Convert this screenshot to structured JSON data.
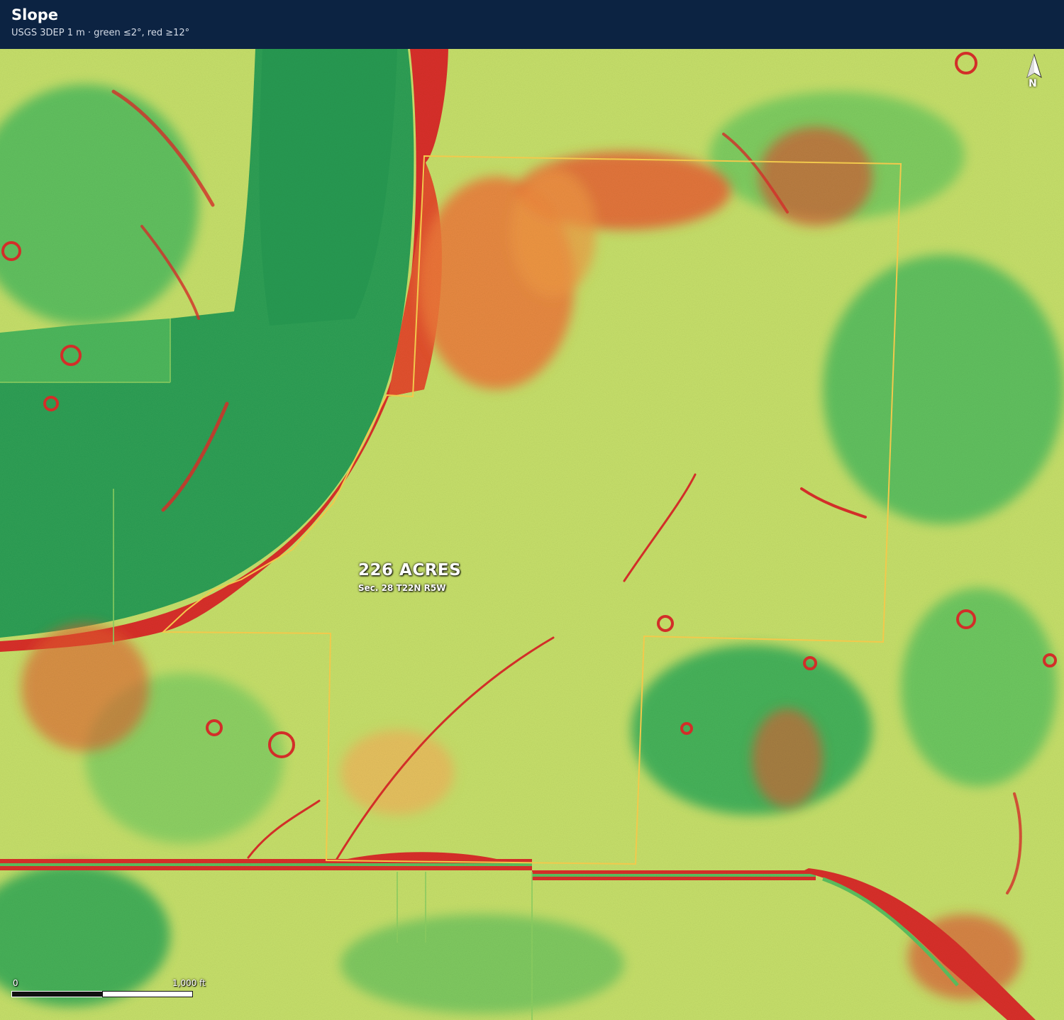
{
  "header": {
    "title": "Slope",
    "subtitle": "USGS 3DEP 1 m · green ≤2°, red ≥12°"
  },
  "legend": {
    "flat_color": "#2ea85a",
    "steep_color": "#d8302a",
    "flat_max_deg": 2,
    "steep_min_deg": 12
  },
  "parcel": {
    "acres_label": "226 ACRES",
    "legal_label": "Sec. 28  T22N  R5W",
    "outline_color": "#f2c94c"
  },
  "north_arrow": {
    "label": "N",
    "icon": "north-arrow-icon"
  },
  "scale_bar": {
    "start_label": "0",
    "end_label": "1,000 ft"
  }
}
